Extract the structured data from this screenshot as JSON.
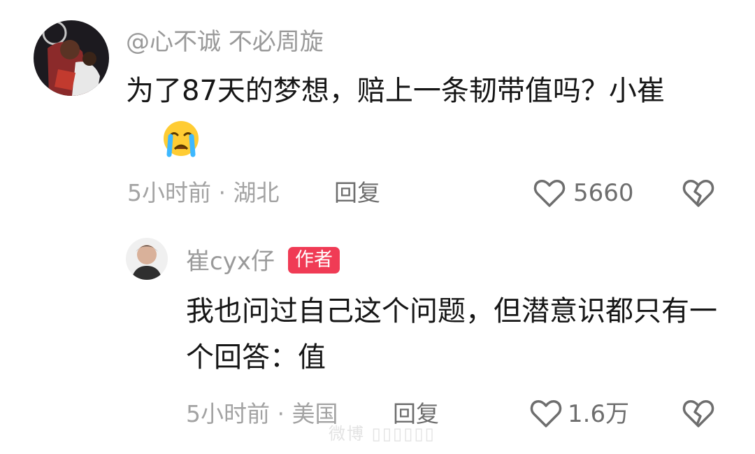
{
  "comment": {
    "username": "@心不诚 不必周旋",
    "text": "为了87天的梦想，赔上一条韧带值吗？小崔",
    "emoji": "crying-face-emoji",
    "time_location": "5小时前 · 湖北",
    "reply_label": "回复",
    "likes": "5660"
  },
  "reply": {
    "username": "崔cyx仔",
    "author_badge": "作者",
    "text": "我也问过自己这个问题，但潜意识都只有一个回答：值",
    "time_location": "5小时前 · 美国",
    "reply_label": "回复",
    "likes": "1.6万"
  },
  "watermark": "微博 ▯▯▯▯▯▯",
  "colors": {
    "badge": "#f03b55",
    "secondary_text": "#9a9a9a",
    "icon": "#6e6e6e"
  }
}
